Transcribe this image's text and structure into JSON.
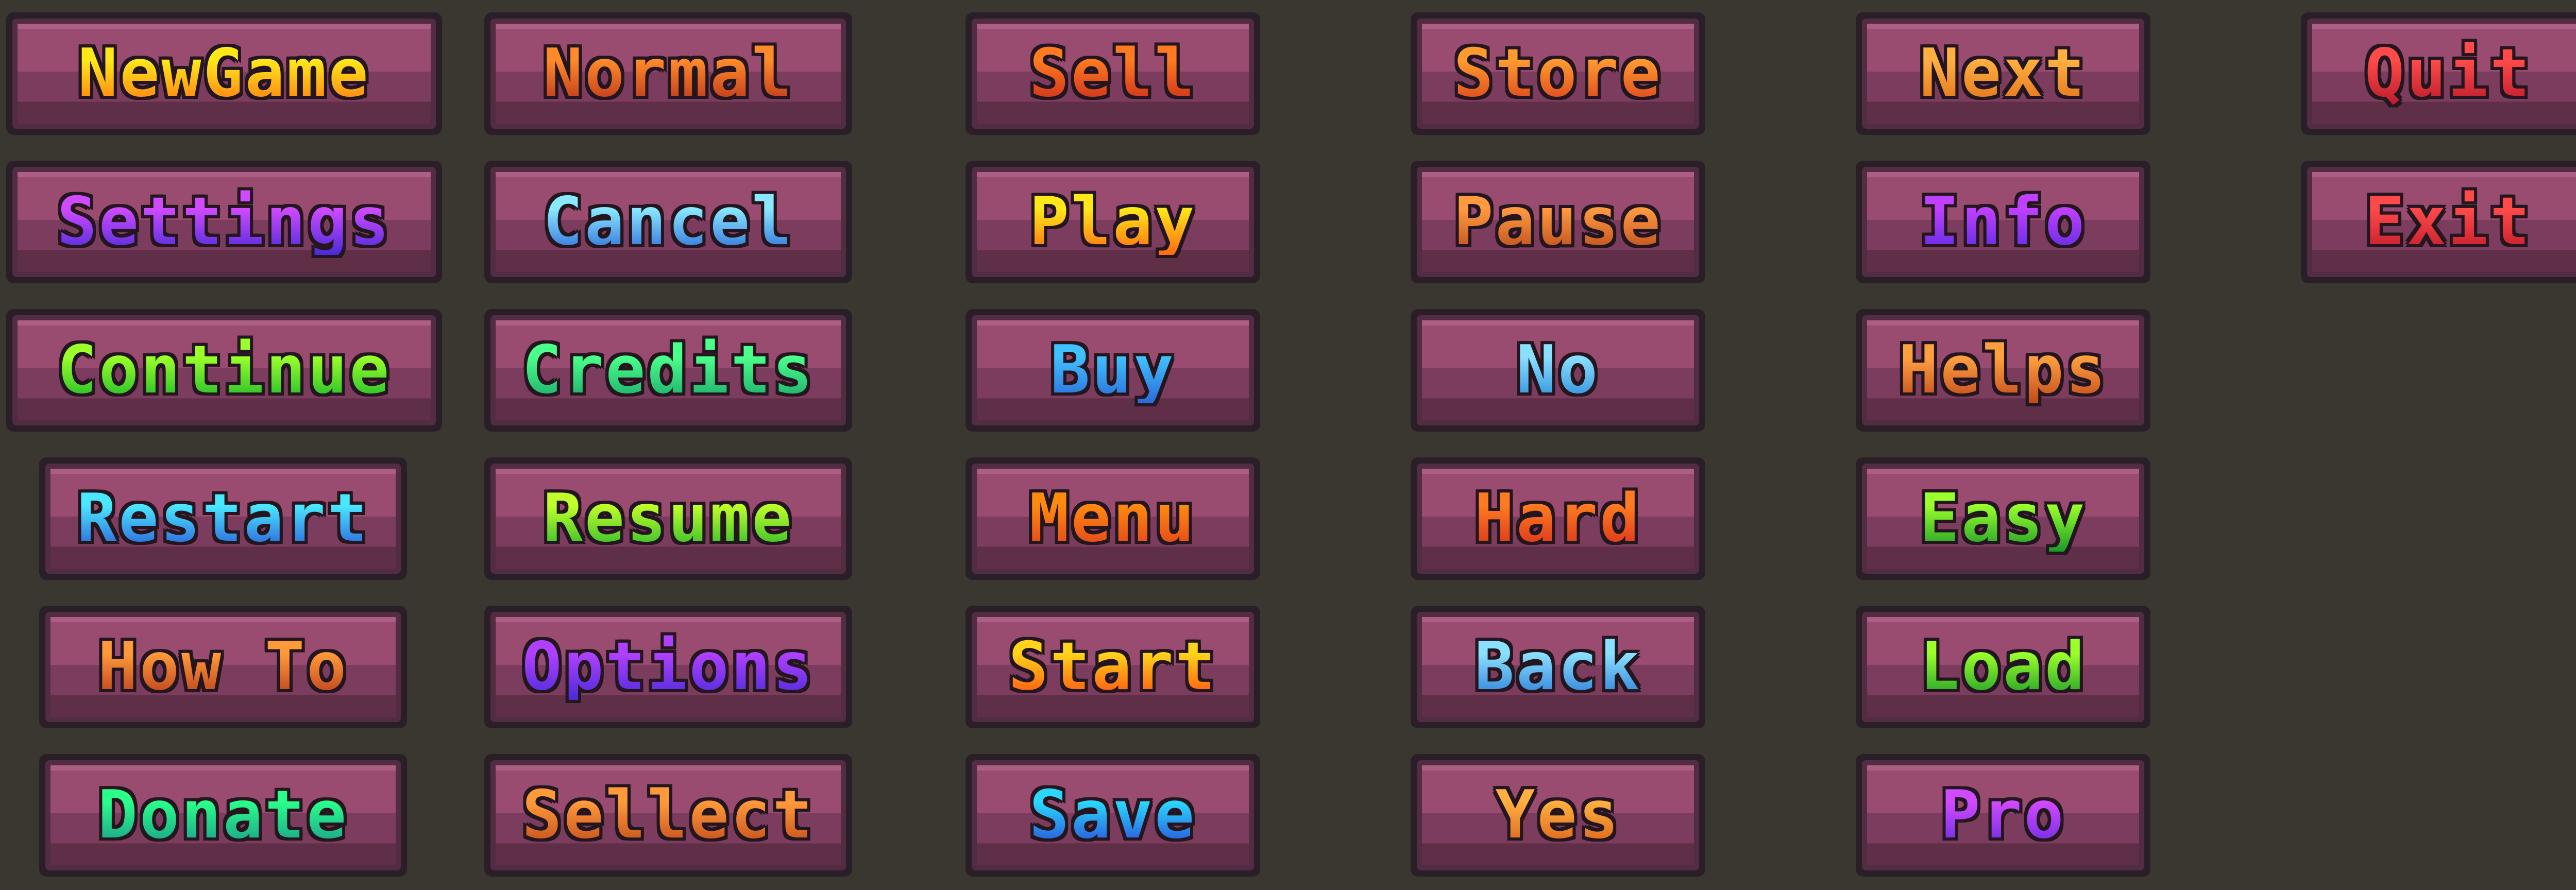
{
  "buttons": [
    {
      "id": "new-game",
      "label": "NewGame",
      "colors": [
        "#ffe81a",
        "#ff7a10"
      ]
    },
    {
      "id": "normal",
      "label": "Normal",
      "colors": [
        "#ff8a2a",
        "#b8321a"
      ]
    },
    {
      "id": "sell",
      "label": "Sell",
      "colors": [
        "#ff7a20",
        "#c82a1a"
      ]
    },
    {
      "id": "store",
      "label": "Store",
      "colors": [
        "#ff9a30",
        "#d8401a"
      ]
    },
    {
      "id": "next",
      "label": "Next",
      "colors": [
        "#ffb040",
        "#e0701a"
      ]
    },
    {
      "id": "quit",
      "label": "Quit",
      "colors": [
        "#ff4a4a",
        "#b81a2a"
      ]
    },
    {
      "id": "settings",
      "label": "Settings",
      "colors": [
        "#d04aff",
        "#4a2ad8"
      ]
    },
    {
      "id": "cancel",
      "label": "Cancel",
      "colors": [
        "#8ae8ff",
        "#2a6ad8"
      ]
    },
    {
      "id": "play",
      "label": "Play",
      "colors": [
        "#ffe81a",
        "#ff6a10"
      ]
    },
    {
      "id": "pause",
      "label": "Pause",
      "colors": [
        "#ff9a40",
        "#b84a1a"
      ]
    },
    {
      "id": "info",
      "label": "Info",
      "colors": [
        "#c040ff",
        "#5a2ae0"
      ]
    },
    {
      "id": "exit",
      "label": "Exit",
      "colors": [
        "#ff4a4a",
        "#c01a2a"
      ]
    },
    {
      "id": "continue",
      "label": "Continue",
      "colors": [
        "#9aff2a",
        "#1ab82a"
      ]
    },
    {
      "id": "credits",
      "label": "Credits",
      "colors": [
        "#4aff8a",
        "#1aa86a"
      ]
    },
    {
      "id": "buy",
      "label": "Buy",
      "colors": [
        "#40c0ff",
        "#2a6ad8"
      ]
    },
    {
      "id": "no",
      "label": "No",
      "colors": [
        "#8ae0ff",
        "#2a8ad8"
      ]
    },
    {
      "id": "helps",
      "label": "Helps",
      "colors": [
        "#ffa040",
        "#c04a1a"
      ]
    },
    {
      "id": "restart",
      "label": "Restart",
      "colors": [
        "#4ae8ff",
        "#2a5ad8"
      ]
    },
    {
      "id": "resume",
      "label": "Resume",
      "colors": [
        "#c0ff2a",
        "#2ab82a"
      ]
    },
    {
      "id": "menu",
      "label": "Menu",
      "colors": [
        "#ff8a10",
        "#e0401a"
      ]
    },
    {
      "id": "hard",
      "label": "Hard",
      "colors": [
        "#ff7a20",
        "#d8301a"
      ]
    },
    {
      "id": "easy",
      "label": "Easy",
      "colors": [
        "#9aff2a",
        "#1a9a2a"
      ]
    },
    {
      "id": "how-to",
      "label": "How To",
      "colors": [
        "#ff9a3a",
        "#b83a1a"
      ]
    },
    {
      "id": "options",
      "label": "Options",
      "colors": [
        "#b040ff",
        "#4a2ad8"
      ]
    },
    {
      "id": "start",
      "label": "Start",
      "colors": [
        "#ffd41a",
        "#ff4a10"
      ]
    },
    {
      "id": "back",
      "label": "Back",
      "colors": [
        "#8ae0ff",
        "#2a7ad8"
      ]
    },
    {
      "id": "load",
      "label": "Load",
      "colors": [
        "#9aff2a",
        "#1a9a2a"
      ]
    },
    {
      "id": "donate",
      "label": "Donate",
      "colors": [
        "#2aff8a",
        "#1a9a8a"
      ]
    },
    {
      "id": "sellect",
      "label": "Sellect",
      "colors": [
        "#ff9a3a",
        "#c04a1a"
      ]
    },
    {
      "id": "save",
      "label": "Save",
      "colors": [
        "#2ad8ff",
        "#2a4ad8"
      ]
    },
    {
      "id": "yes",
      "label": "Yes",
      "colors": [
        "#ffb040",
        "#d8601a"
      ]
    },
    {
      "id": "pro",
      "label": "Pro",
      "colors": [
        "#d04aff",
        "#6a2ae0"
      ]
    }
  ]
}
